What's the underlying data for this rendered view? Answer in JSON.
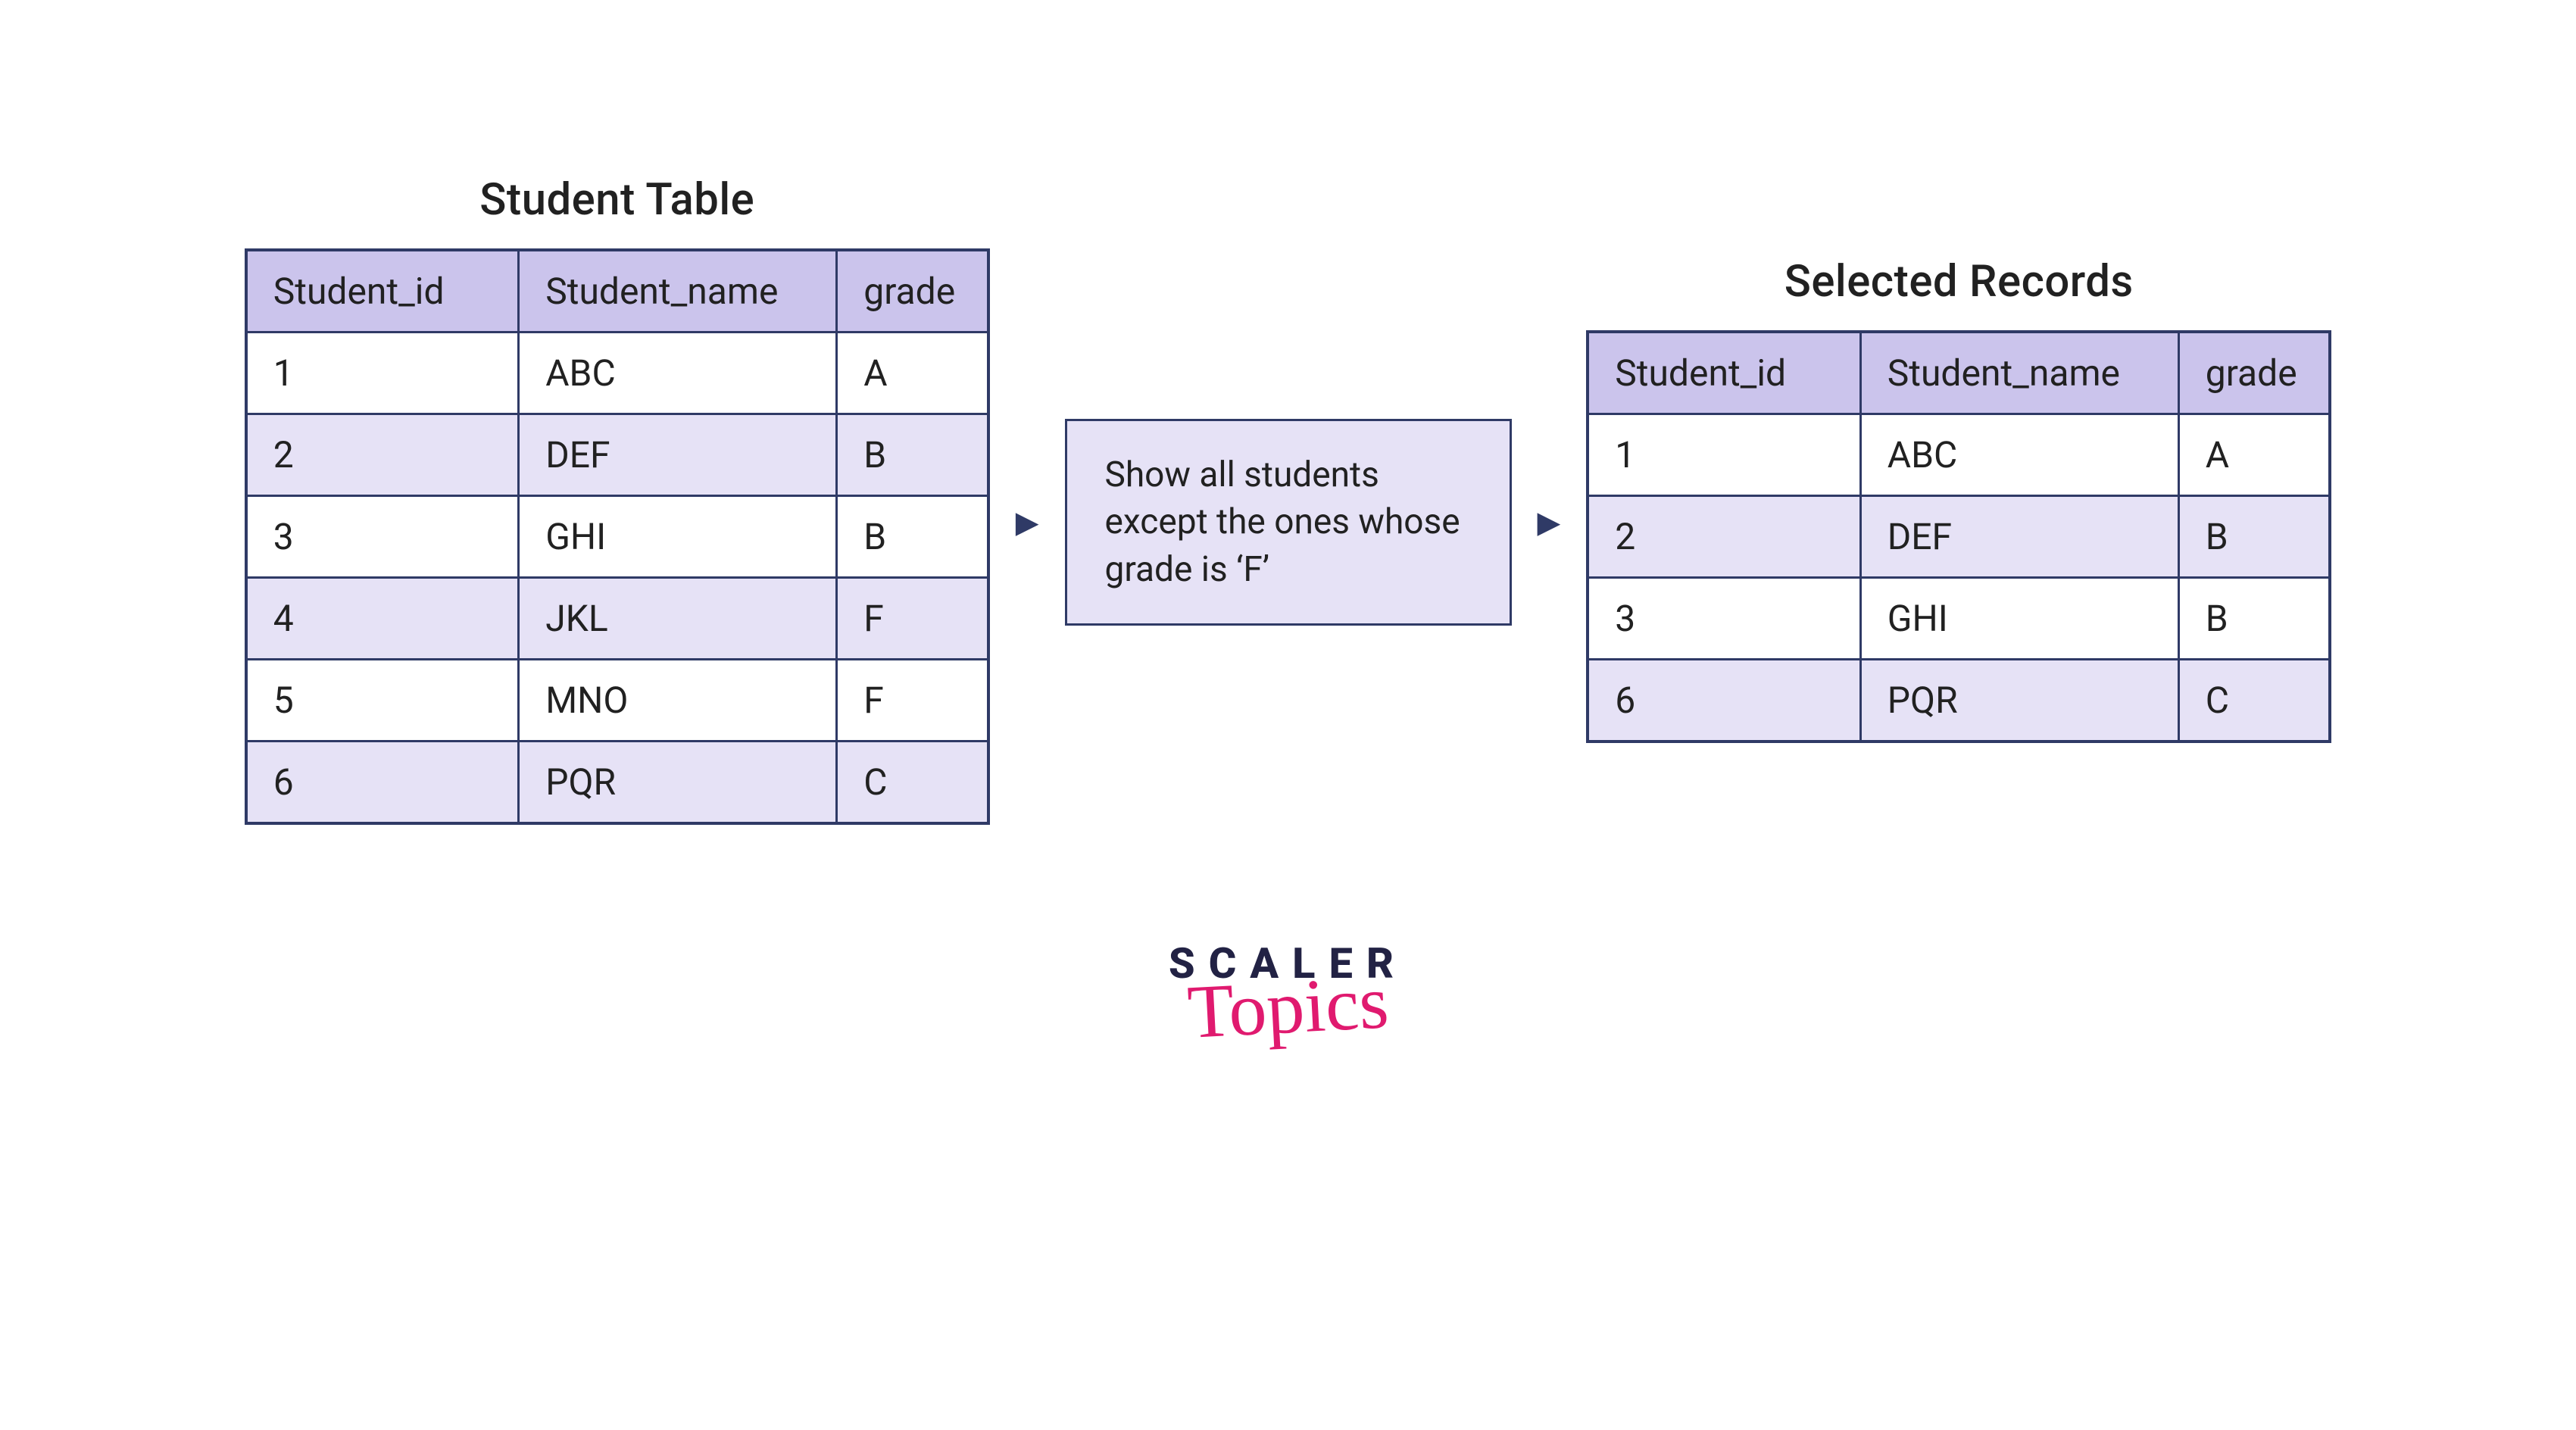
{
  "left": {
    "title": "Student Table",
    "headers": [
      "Student_id",
      "Student_name",
      "grade"
    ],
    "rows": [
      [
        "1",
        "ABC",
        "A"
      ],
      [
        "2",
        "DEF",
        "B"
      ],
      [
        "3",
        "GHI",
        "B"
      ],
      [
        "4",
        "JKL",
        "F"
      ],
      [
        "5",
        "MNO",
        "F"
      ],
      [
        "6",
        "PQR",
        "C"
      ]
    ]
  },
  "filter": {
    "text": "Show all students except the ones whose grade is ‘F’"
  },
  "right": {
    "title": "Selected Records",
    "headers": [
      "Student_id",
      "Student_name",
      "grade"
    ],
    "rows": [
      [
        "1",
        "ABC",
        "A"
      ],
      [
        "2",
        "DEF",
        "B"
      ],
      [
        "3",
        "GHI",
        "B"
      ],
      [
        "6",
        "PQR",
        "C"
      ]
    ]
  },
  "logo": {
    "top": "SCALER",
    "bottom": "Topics"
  },
  "arrow_glyph": "▶"
}
